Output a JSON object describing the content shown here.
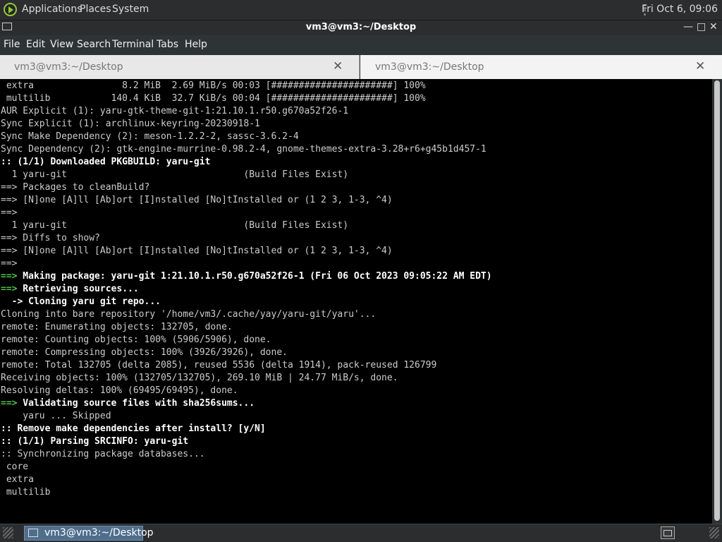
{
  "topbar": {
    "menus": [
      "Applications",
      "Places",
      "System"
    ],
    "clock": "Fri Oct  6, 09:06"
  },
  "window": {
    "title": "vm3@vm3:~/Desktop",
    "controls": {
      "minimize": "—",
      "maximize": "□",
      "close": "✕"
    }
  },
  "menubar": [
    "File",
    "Edit",
    "View",
    "Search",
    "Terminal",
    "Tabs",
    "Help"
  ],
  "tabs": [
    {
      "label": "vm3@vm3:~/Desktop",
      "close": "✕",
      "active": false
    },
    {
      "label": "vm3@vm3:~/Desktop",
      "close": "✕",
      "active": true
    }
  ],
  "terminal": {
    "lines": [
      {
        "text": " extra                8.2 MiB  2.69 MiB/s 00:03 [######################] 100%",
        "style": ""
      },
      {
        "text": " multilib           140.4 KiB  32.7 KiB/s 00:04 [######################] 100%",
        "style": ""
      },
      {
        "text": "AUR Explicit (1): yaru-gtk-theme-git-1:21.10.1.r50.g670a52f26-1",
        "style": ""
      },
      {
        "text": "Sync Explicit (1): archlinux-keyring-20230918-1",
        "style": ""
      },
      {
        "text": "Sync Make Dependency (2): meson-1.2.2-2, sassc-3.6.2-4",
        "style": ""
      },
      {
        "text": "Sync Dependency (2): gtk-engine-murrine-0.98.2-4, gnome-themes-extra-3.28+r6+g45b1d457-1",
        "style": ""
      },
      {
        "text": ":: (1/1) Downloaded PKGBUILD: yaru-git",
        "style": "b"
      },
      {
        "text": "  1 yaru-git                                (Build Files Exist)",
        "style": ""
      },
      {
        "text": "==> Packages to cleanBuild?",
        "style": ""
      },
      {
        "text": "==> [N]one [A]ll [Ab]ort [I]nstalled [No]tInstalled or (1 2 3, 1-3, ^4)",
        "style": ""
      },
      {
        "text": "==>",
        "style": ""
      },
      {
        "text": "  1 yaru-git                                (Build Files Exist)",
        "style": ""
      },
      {
        "text": "==> Diffs to show?",
        "style": ""
      },
      {
        "text": "==> [N]one [A]ll [Ab]ort [I]nstalled [No]tInstalled or (1 2 3, 1-3, ^4)",
        "style": ""
      },
      {
        "text": "==>",
        "style": ""
      },
      {
        "prefix": "==>",
        "text": " Making package: yaru-git 1:21.10.1.r50.g670a52f26-1 (Fri 06 Oct 2023 09:05:22 AM EDT)",
        "style": "gb"
      },
      {
        "prefix": "==>",
        "text": " Retrieving sources...",
        "style": "gb"
      },
      {
        "text": "  -> Cloning yaru git repo...",
        "style": "b"
      },
      {
        "text": "Cloning into bare repository '/home/vm3/.cache/yay/yaru-git/yaru'...",
        "style": ""
      },
      {
        "text": "remote: Enumerating objects: 132705, done.",
        "style": ""
      },
      {
        "text": "remote: Counting objects: 100% (5906/5906), done.",
        "style": ""
      },
      {
        "text": "remote: Compressing objects: 100% (3926/3926), done.",
        "style": ""
      },
      {
        "text": "remote: Total 132705 (delta 2085), reused 5536 (delta 1914), pack-reused 126799",
        "style": ""
      },
      {
        "text": "Receiving objects: 100% (132705/132705), 269.10 MiB | 24.77 MiB/s, done.",
        "style": ""
      },
      {
        "text": "Resolving deltas: 100% (69495/69495), done.",
        "style": ""
      },
      {
        "prefix": "==>",
        "text": " Validating source files with sha256sums...",
        "style": "gb"
      },
      {
        "text": "    yaru ... Skipped",
        "style": ""
      },
      {
        "text": ":: Remove make dependencies after install? [y/N]",
        "style": "b"
      },
      {
        "text": ":: (1/1) Parsing SRCINFO: yaru-git",
        "style": "b"
      },
      {
        "text": ":: Synchronizing package databases...",
        "style": ""
      },
      {
        "text": " core",
        "style": ""
      },
      {
        "text": " extra",
        "style": ""
      },
      {
        "text": " multilib",
        "style": ""
      }
    ]
  },
  "taskbar": {
    "window_button": "vm3@vm3:~/Desktop"
  }
}
